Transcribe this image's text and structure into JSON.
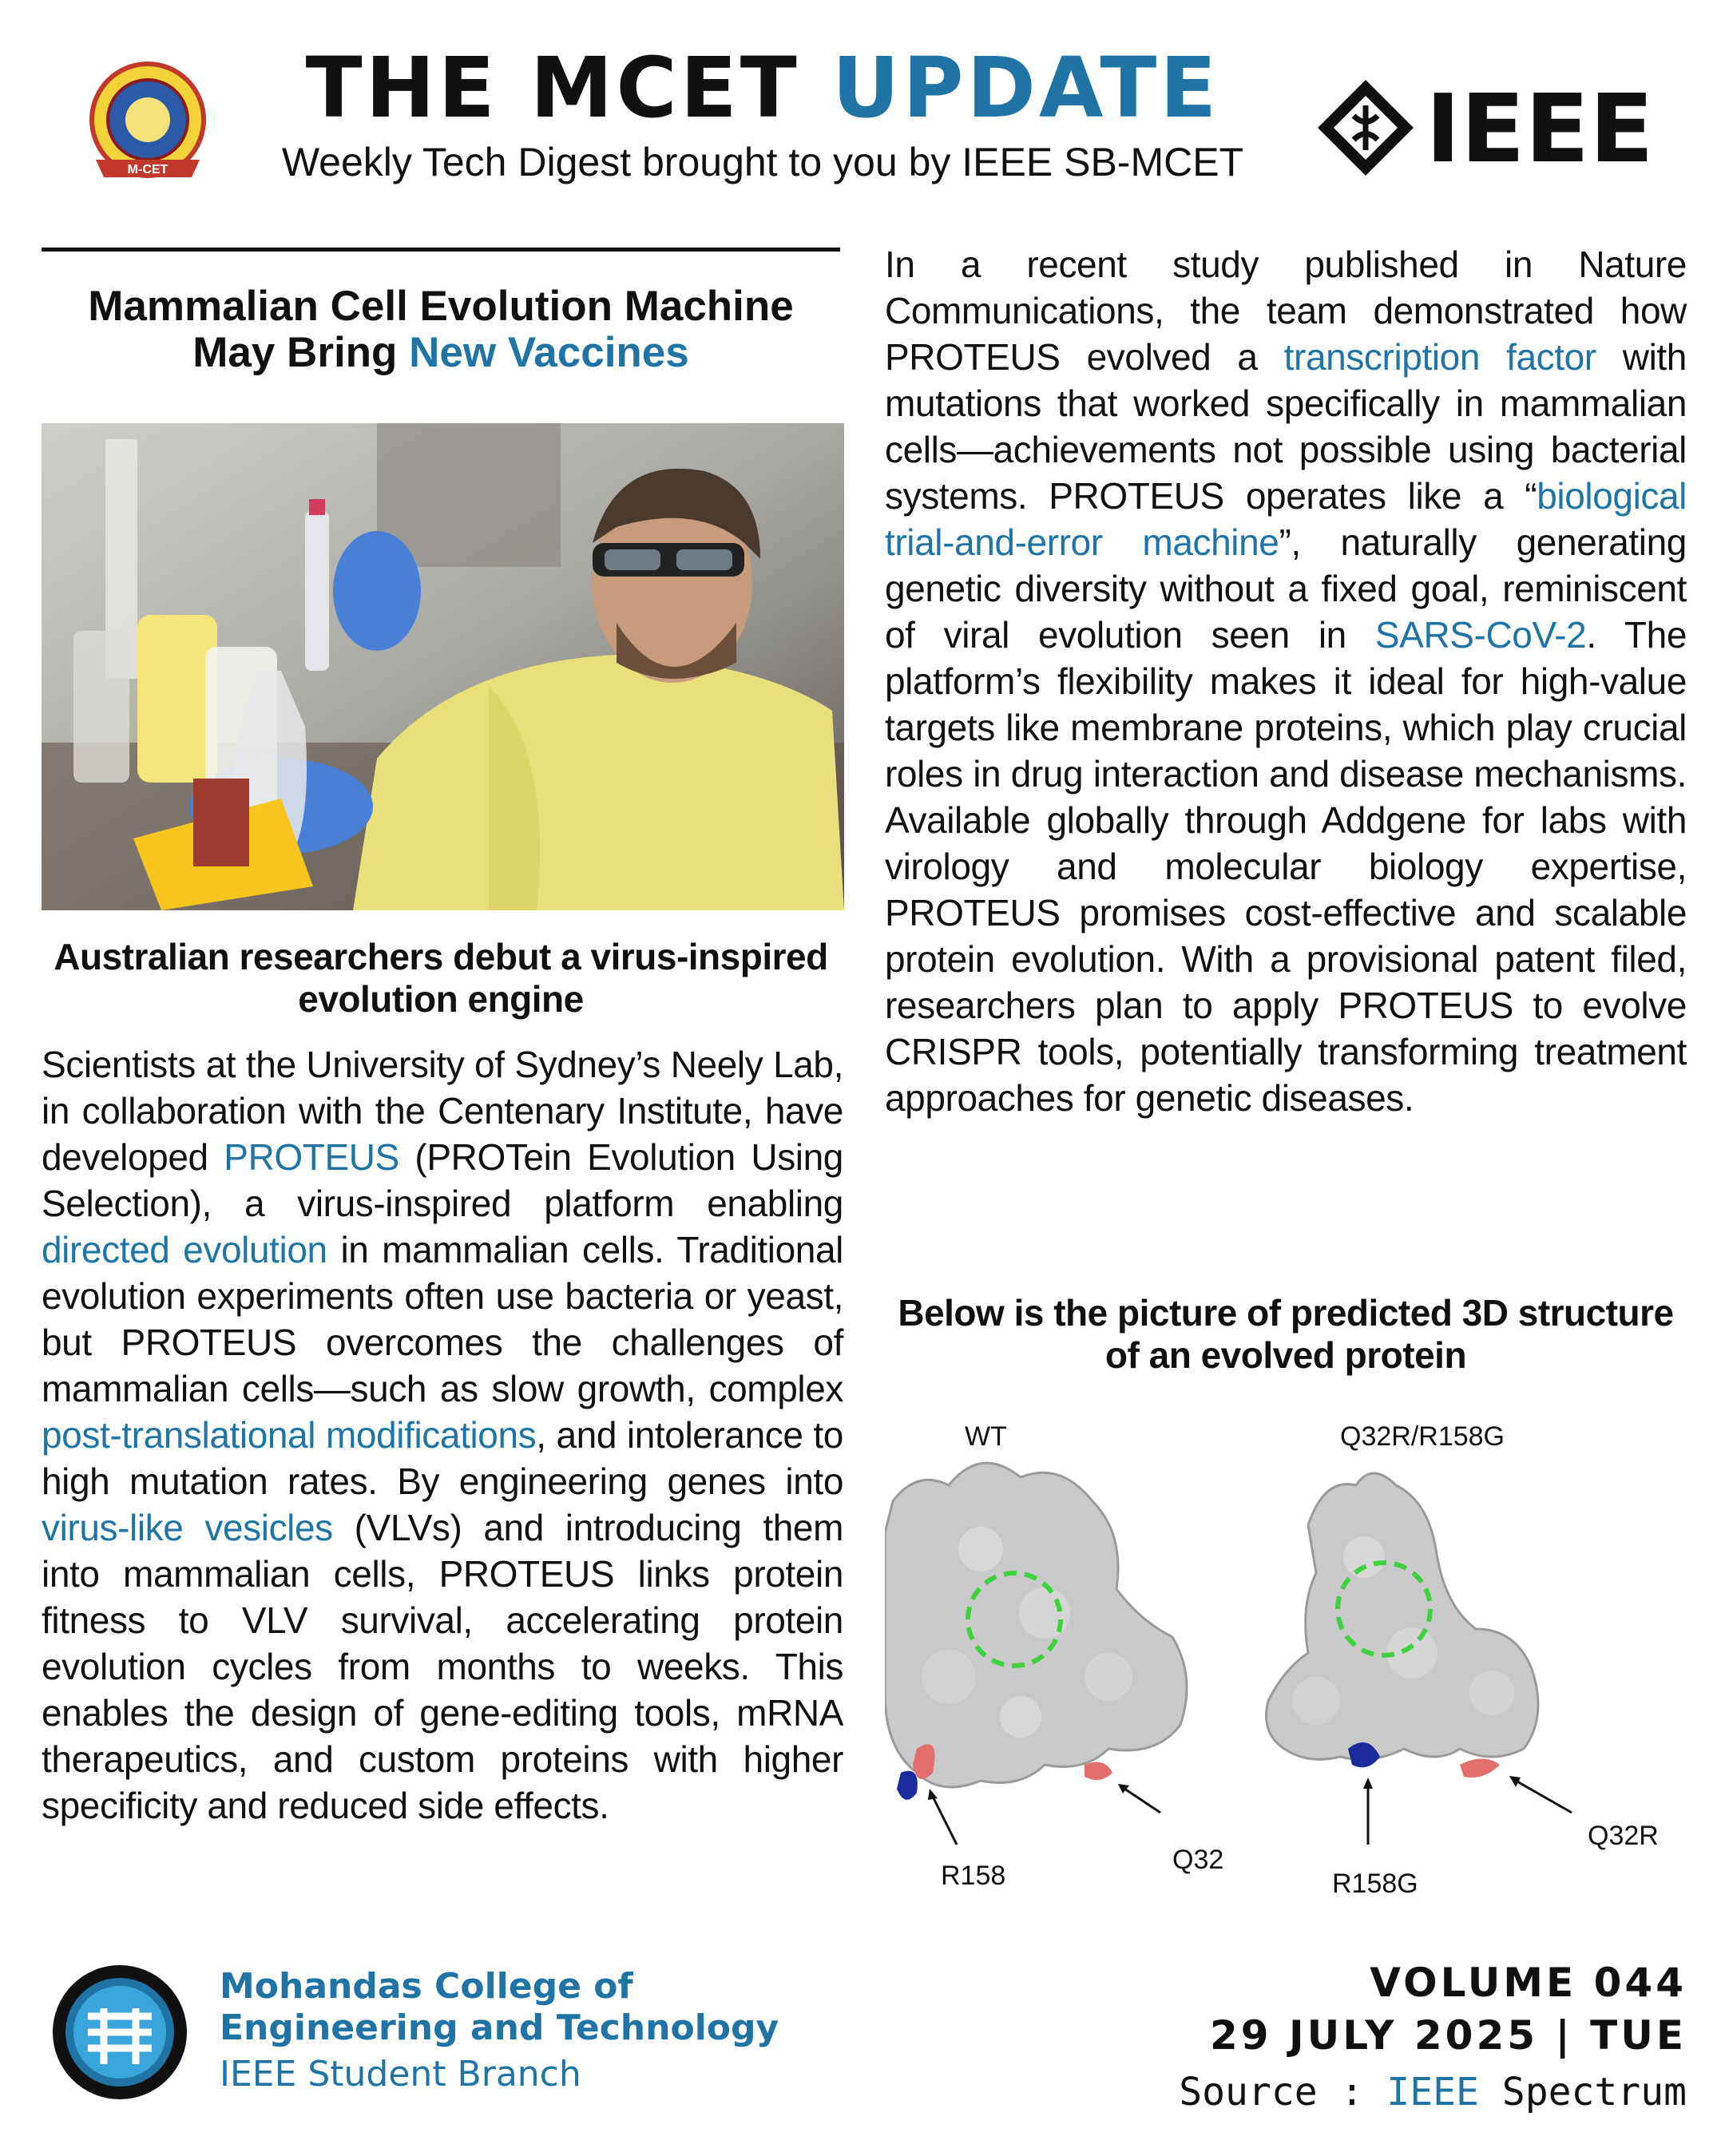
{
  "header": {
    "title_part1": "THE MCET ",
    "title_part2": "UPDATE",
    "subtitle": "Weekly Tech Digest brought to you by IEEE SB-MCET",
    "left_logo_text": "M-CET",
    "right_logo_text": "IEEE"
  },
  "article": {
    "headline_line1": "Mammalian Cell Evolution Machine",
    "headline_line2_prefix": "May Bring ",
    "headline_line2_highlight": "New Vaccines",
    "subheading": "Australian researchers debut a virus-inspired evolution engine",
    "left_body": {
      "p1": "Scientists at the University of Sydney’s Neely Lab, in collaboration with the Centenary Institute, have developed ",
      "link1": "PROTEUS",
      "p2": " (PROTein Evolution Using Selection), a virus-inspired platform enabling ",
      "link2": "directed evolution",
      "p3": " in mammalian cells. Traditional evolution experiments often use bacteria or yeast, but PROTEUS overcomes the challenges of mammalian cells—such as slow growth, complex ",
      "link3": "post-translational modifications",
      "p4": ", and intolerance to high mutation rates. By engineering genes into ",
      "link4": "virus-like vesicles",
      "p5": " (VLVs) and introducing them into mammalian cells, PROTEUS links protein fitness to VLV survival, accelerating protein evolution cycles from months to weeks. This enables the design of gene-editing tools, mRNA therapeutics, and custom proteins with higher specificity and reduced side effects."
    },
    "right_body": {
      "p1": "In a recent study published in Nature Communications, the team demonstrated how PROTEUS evolved a ",
      "link1": "transcription factor",
      "p2": " with mutations that worked specifically in mammalian cells—achievements not possible using bacterial systems. PROTEUS operates like a “",
      "link2": "biological trial-and-error machine",
      "p3": "”, naturally generating genetic diversity without a fixed goal, reminiscent of viral evolution seen in ",
      "link3": "SARS-CoV-2",
      "p4": ". The platform’s flexibility makes it ideal for high-value targets like membrane proteins, which play crucial roles in drug interaction and disease mechanisms. Available globally through Addgene for labs with virology and molecular biology expertise, PROTEUS promises cost-effective and scalable protein evolution. With a provisional patent filed, researchers plan to apply PROTEUS to evolve CRISPR tools, potentially transforming treatment approaches for genetic diseases."
    },
    "figure_caption": "Below is the picture of predicted 3D structure of an evolved protein",
    "figure_labels": {
      "wt": "WT",
      "mutant": "Q32R/R158G",
      "wt_r158": "R158",
      "wt_q32": "Q32",
      "mut_r158g": "R158G",
      "mut_q32r": "Q32R"
    }
  },
  "footer": {
    "college_line1": "Mohandas College of",
    "college_line2": "Engineering and Technology",
    "branch": "IEEE Student Branch",
    "volume": "VOLUME 044",
    "date": "29 JULY 2025 | TUE",
    "source_prefix": "Source : ",
    "source_ieee": "IEEE",
    "source_suffix": " Spectrum"
  },
  "colors": {
    "accent": "#1f74a5",
    "text": "#111111",
    "gown": "#e8e07a",
    "glove": "#4a7fd6"
  }
}
